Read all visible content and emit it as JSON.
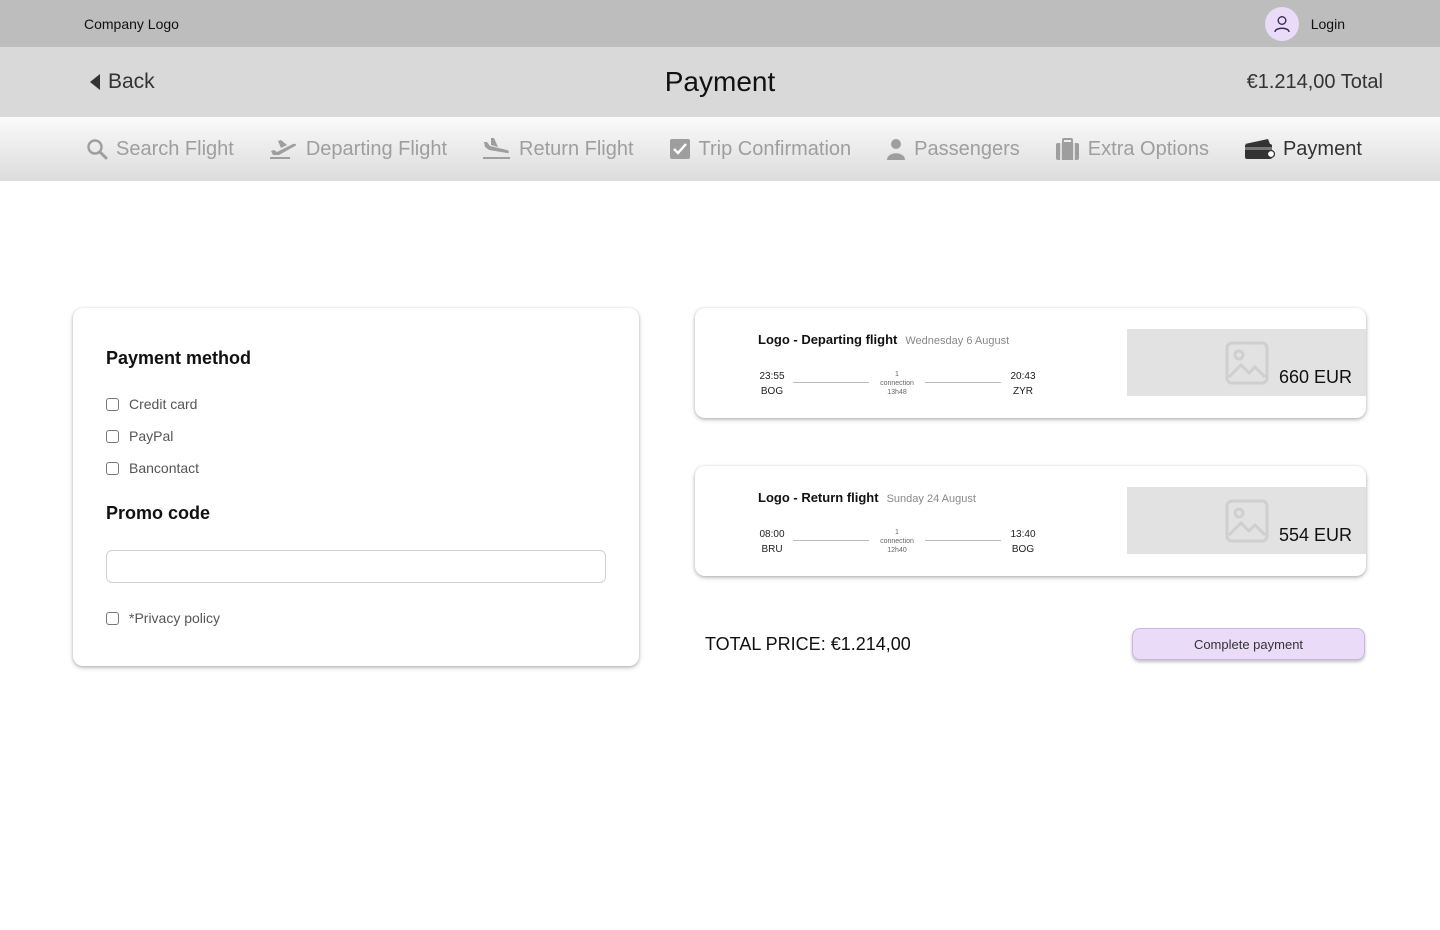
{
  "topbar": {
    "company_logo": "Company Logo",
    "login_label": "Login",
    "avatar_icon": "user-icon"
  },
  "header": {
    "back_label": "Back",
    "title": "Payment",
    "total": "€1.214,00 Total"
  },
  "steps": [
    {
      "label": "Search Flight",
      "icon": "search-icon",
      "active": false
    },
    {
      "label": "Departing Flight",
      "icon": "plane-takeoff-icon",
      "active": false
    },
    {
      "label": "Return Flight",
      "icon": "plane-landing-icon",
      "active": false
    },
    {
      "label": "Trip Confirmation",
      "icon": "checkbox-icon",
      "active": false
    },
    {
      "label": "Passengers",
      "icon": "person-icon",
      "active": false
    },
    {
      "label": "Extra Options",
      "icon": "luggage-icon",
      "active": false
    },
    {
      "label": "Payment",
      "icon": "wallet-icon",
      "active": true
    }
  ],
  "payment": {
    "method_title": "Payment method",
    "methods": [
      "Credit card",
      "PayPal",
      "Bancontact"
    ],
    "promo_title": "Promo code",
    "promo_value": "",
    "privacy_label": "*Privacy policy"
  },
  "flights": [
    {
      "name": "Logo - Departing flight",
      "date": "Wednesday 6 August",
      "dep_time": "23:55",
      "dep_airport": "BOG",
      "connections": "1",
      "connection_label": "connection",
      "duration": "13h48",
      "arr_time": "20:43",
      "arr_airport": "ZYR",
      "price": "660 EUR"
    },
    {
      "name": "Logo - Return flight",
      "date": "Sunday 24 August",
      "dep_time": "08:00",
      "dep_airport": "BRU",
      "connections": "1",
      "connection_label": "connection",
      "duration": "12h40",
      "arr_time": "13:40",
      "arr_airport": "BOG",
      "price": "554 EUR"
    }
  ],
  "summary": {
    "total_price": "TOTAL PRICE: €1.214,00",
    "complete_button": "Complete payment"
  },
  "colors": {
    "accent": "#eadcf9",
    "topbar": "#bdbdbd",
    "header": "#d9d9d9"
  }
}
